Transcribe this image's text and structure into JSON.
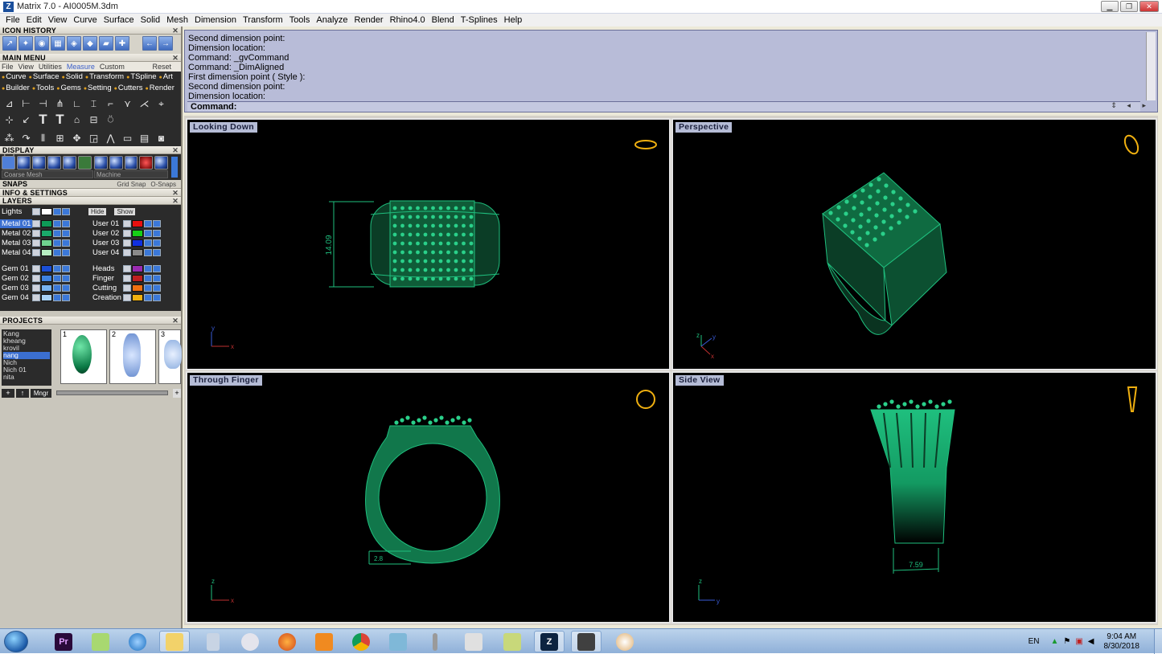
{
  "window": {
    "title": "Matrix 7.0 - AI0005M.3dm",
    "controls": [
      "minimize",
      "restore",
      "close"
    ]
  },
  "menubar": {
    "items": [
      "File",
      "Edit",
      "View",
      "Curve",
      "Surface",
      "Solid",
      "Mesh",
      "Dimension",
      "Transform",
      "Tools",
      "Analyze",
      "Render",
      "Rhino4.0",
      "Blend",
      "T-Splines",
      "Help"
    ]
  },
  "left_panel": {
    "icon_history_title": "ICON HISTORY",
    "main_menu_title": "MAIN MENU",
    "main_menu_tabs": [
      "File",
      "View",
      "Utilities",
      "Measure",
      "Custom",
      "Reset"
    ],
    "active_tab": "Measure",
    "categories": [
      "Curve",
      "Surface",
      "Solid",
      "Transform",
      "TSpline",
      "Art",
      "Builder",
      "Tools",
      "Gems",
      "Setting",
      "Cutters",
      "Render"
    ],
    "display_title": "DISPLAY",
    "display_mesh": "Coarse Mesh",
    "display_material": "Machine",
    "snaps_title": "SNAPS",
    "snaps_grid": "Grid Snap",
    "snaps_osnap": "O-Snaps",
    "info_title": "INFO & SETTINGS",
    "layers_title": "LAYERS",
    "lights_label": "Lights",
    "hide_label": "Hide",
    "show_label": "Show",
    "layers_left": [
      {
        "name": "Metal 01",
        "color": "#0e9a57",
        "selected": true
      },
      {
        "name": "Metal 02",
        "color": "#1aa86a",
        "selected": false
      },
      {
        "name": "Metal 03",
        "color": "#6fd28f",
        "selected": false
      },
      {
        "name": "Metal 04",
        "color": "#b8efc3",
        "selected": false
      },
      {
        "name": "Gem 01",
        "color": "#1b4fd6",
        "selected": false
      },
      {
        "name": "Gem 02",
        "color": "#3f82e0",
        "selected": false
      },
      {
        "name": "Gem 03",
        "color": "#79b3f0",
        "selected": false
      },
      {
        "name": "Gem 04",
        "color": "#a9d2f7",
        "selected": false
      }
    ],
    "layers_right": [
      {
        "name": "User 01",
        "color": "#e81010"
      },
      {
        "name": "User 02",
        "color": "#16d016"
      },
      {
        "name": "User 03",
        "color": "#1030e0"
      },
      {
        "name": "User 04",
        "color": "#8a8a8a"
      },
      {
        "name": "Heads",
        "color": "#9a2ab0"
      },
      {
        "name": "Finger",
        "color": "#c02020"
      },
      {
        "name": "Cutting",
        "color": "#f07010"
      },
      {
        "name": "Creation",
        "color": "#f0b010"
      }
    ],
    "projects_title": "PROJECTS",
    "projects": [
      "Kang",
      "kheang",
      "krovil",
      "nang",
      "Nich",
      "Nich 01",
      "nita"
    ],
    "selected_project": "nang",
    "thumbnails": [
      "1",
      "2",
      "3"
    ],
    "mngr_label": "Mngr"
  },
  "command": {
    "log": [
      "Second dimension point:",
      "Dimension location:",
      "Command: _gvCommand",
      "Command: _DimAligned",
      "First dimension point ( Style ):",
      "Second dimension point:",
      "Dimension location:"
    ],
    "prompt": "Command:"
  },
  "viewports": {
    "top_left": {
      "label": "Looking Down",
      "dimension": "14.09"
    },
    "top_right": {
      "label": "Perspective"
    },
    "bottom_left": {
      "label": "Through Finger",
      "dimension": "2.8"
    },
    "bottom_right": {
      "label": "Side View",
      "dimension": "7.59"
    }
  },
  "taskbar": {
    "language": "EN",
    "time": "9:04 AM",
    "date": "8/30/2018"
  },
  "colors": {
    "model_green": "#1fbf7e",
    "viewport_bg": "#000000",
    "label_bg": "#b5bcd6",
    "command_bg": "#b8bcd8"
  }
}
